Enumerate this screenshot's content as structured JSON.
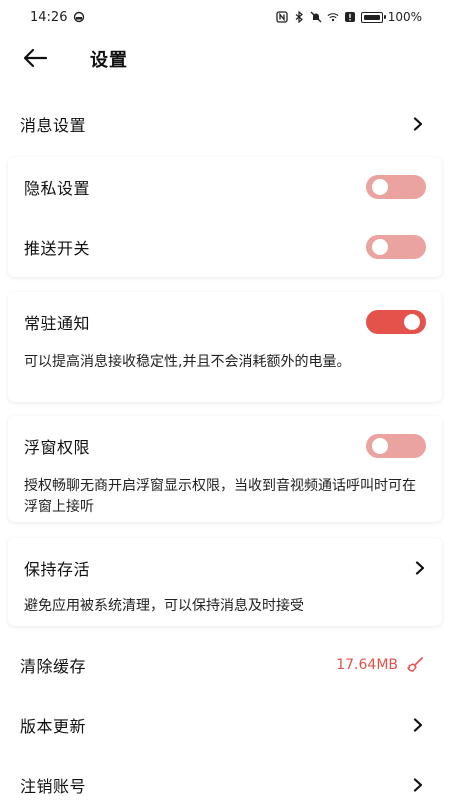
{
  "status_bar": {
    "time": "14:26",
    "battery_text": "100%"
  },
  "header": {
    "title": "设置"
  },
  "rows": {
    "message_settings": "消息设置",
    "clear_cache": "清除缓存",
    "cache_size": "17.64MB",
    "version_update": "版本更新",
    "cancel_account": "注销账号"
  },
  "privacy_card": {
    "privacy_label": "隐私设置",
    "privacy_on": false,
    "push_label": "推送开关",
    "push_on": false
  },
  "resident_card": {
    "label": "常驻通知",
    "on": true,
    "desc": "可以提高消息接收稳定性,并且不会消耗额外的电量。"
  },
  "float_card": {
    "label": "浮窗权限",
    "on": false,
    "desc": "授权畅聊无商开启浮窗显示权限，当收到音视频通话呼叫时可在浮窗上接听"
  },
  "keepalive_card": {
    "label": "保持存活",
    "desc": "避免应用被系统清理，可以保持消息及时接受"
  },
  "colors": {
    "accent": "#e4524b",
    "toggle_off": "#eba3a0"
  }
}
